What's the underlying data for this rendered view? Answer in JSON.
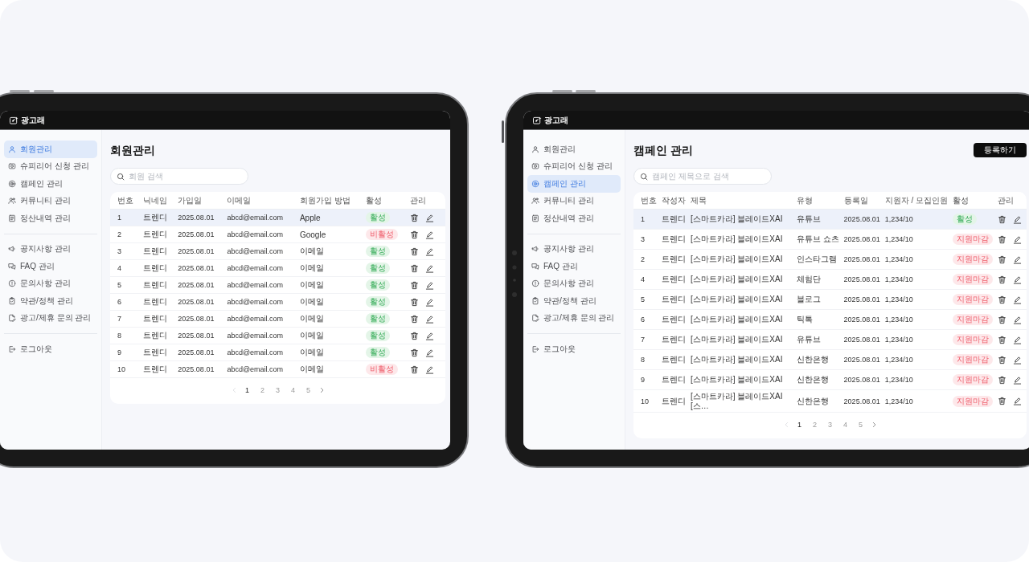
{
  "screens": [
    {
      "top_bar": {
        "logo": "광고래"
      },
      "sidebar": {
        "sections": [
          {
            "items": [
              {
                "label": "회원관리",
                "selected": true
              },
              {
                "label": "슈피리어 신청 관리",
                "selected": false
              },
              {
                "label": "캠페인 관리",
                "selected": false
              },
              {
                "label": "커뮤니티 관리",
                "selected": false
              },
              {
                "label": "정산내역 관리",
                "selected": false
              }
            ]
          },
          {
            "items": [
              {
                "label": "공지사항 관리",
                "selected": false
              },
              {
                "label": "FAQ 관리",
                "selected": false
              },
              {
                "label": "문의사항 관리",
                "selected": false
              },
              {
                "label": "약관/정책 관리",
                "selected": false
              },
              {
                "label": "광고/제휴 문의 관리",
                "selected": false
              }
            ]
          },
          {
            "items": [
              {
                "label": "로그아웃",
                "selected": false
              }
            ]
          }
        ]
      },
      "page": {
        "title": "회원관리",
        "search": {
          "placeholder": "회원 검색"
        },
        "table": {
          "columns": [
            {
              "label": "번호",
              "kind": "number"
            },
            {
              "label": "닉네임",
              "kind": "text"
            },
            {
              "label": "가입일",
              "kind": "figure"
            },
            {
              "label": "이메일",
              "kind": "figure"
            },
            {
              "label": "회원가입 방법",
              "kind": "text"
            },
            {
              "label": "활성",
              "kind": "status"
            },
            {
              "label": "관리",
              "kind": "actions"
            }
          ],
          "rows": [
            {
              "selected": true,
              "cells": [
                "1",
                "트렌디",
                "2025.08.01",
                "abcd@email.com",
                "Apple"
              ],
              "status": {
                "label": "활성",
                "active": true
              }
            },
            {
              "selected": false,
              "cells": [
                "2",
                "트렌디",
                "2025.08.01",
                "abcd@email.com",
                "Google"
              ],
              "status": {
                "label": "비활성",
                "active": false
              }
            },
            {
              "selected": false,
              "cells": [
                "3",
                "트렌디",
                "2025.08.01",
                "abcd@email.com",
                "이메일"
              ],
              "status": {
                "label": "활성",
                "active": true
              }
            },
            {
              "selected": false,
              "cells": [
                "4",
                "트렌디",
                "2025.08.01",
                "abcd@email.com",
                "이메일"
              ],
              "status": {
                "label": "활성",
                "active": true
              }
            },
            {
              "selected": false,
              "cells": [
                "5",
                "트렌디",
                "2025.08.01",
                "abcd@email.com",
                "이메일"
              ],
              "status": {
                "label": "활성",
                "active": true
              }
            },
            {
              "selected": false,
              "cells": [
                "6",
                "트렌디",
                "2025.08.01",
                "abcd@email.com",
                "이메일"
              ],
              "status": {
                "label": "활성",
                "active": true
              }
            },
            {
              "selected": false,
              "cells": [
                "7",
                "트렌디",
                "2025.08.01",
                "abcd@email.com",
                "이메일"
              ],
              "status": {
                "label": "활성",
                "active": true
              }
            },
            {
              "selected": false,
              "cells": [
                "8",
                "트렌디",
                "2025.08.01",
                "abcd@email.com",
                "이메일"
              ],
              "status": {
                "label": "활성",
                "active": true
              }
            },
            {
              "selected": false,
              "cells": [
                "9",
                "트렌디",
                "2025.08.01",
                "abcd@email.com",
                "이메일"
              ],
              "status": {
                "label": "활성",
                "active": true
              }
            },
            {
              "selected": false,
              "cells": [
                "10",
                "트렌디",
                "2025.08.01",
                "abcd@email.com",
                "이메일"
              ],
              "status": {
                "label": "비활성",
                "active": false
              }
            }
          ]
        },
        "pagination": {
          "previous": {
            "disabled": true
          },
          "pages": [
            {
              "label": "1",
              "selected": true
            },
            {
              "label": "2",
              "selected": false
            },
            {
              "label": "3",
              "selected": false
            },
            {
              "label": "4",
              "selected": false
            },
            {
              "label": "5",
              "selected": false
            }
          ],
          "next": {
            "disabled": false
          }
        }
      }
    },
    {
      "top_bar": {
        "logo": "광고래"
      },
      "sidebar": {
        "sections": [
          {
            "items": [
              {
                "label": "회원관리",
                "selected": false
              },
              {
                "label": "슈피리어 신청 관리",
                "selected": false
              },
              {
                "label": "캠페인 관리",
                "selected": true
              },
              {
                "label": "커뮤니티 관리",
                "selected": false
              },
              {
                "label": "정산내역 관리",
                "selected": false
              }
            ]
          },
          {
            "items": [
              {
                "label": "공지사항 관리",
                "selected": false
              },
              {
                "label": "FAQ 관리",
                "selected": false
              },
              {
                "label": "문의사항 관리",
                "selected": false
              },
              {
                "label": "약관/정책 관리",
                "selected": false
              },
              {
                "label": "광고/제휴 문의 관리",
                "selected": false
              }
            ]
          },
          {
            "items": [
              {
                "label": "로그아웃",
                "selected": false
              }
            ]
          }
        ]
      },
      "page": {
        "title": "캠페인 관리",
        "action_button": "등록하기",
        "search": {
          "placeholder": "캠페인 제목으로 검색"
        },
        "table": {
          "columns": [
            {
              "label": "번호",
              "kind": "number"
            },
            {
              "label": "작성자",
              "kind": "text"
            },
            {
              "label": "제목",
              "kind": "title"
            },
            {
              "label": "유형",
              "kind": "text"
            },
            {
              "label": "등록일",
              "kind": "figure"
            },
            {
              "label": "지원자 / 모집인원",
              "kind": "figure"
            },
            {
              "label": "활성",
              "kind": "status"
            },
            {
              "label": "관리",
              "kind": "actions"
            }
          ],
          "rows": [
            {
              "selected": true,
              "cells": [
                "1",
                "트렌디",
                "[스마트카라] 블레이드XAI",
                "유튜브",
                "2025.08.01",
                "1,234/10"
              ],
              "status": {
                "label": "활성",
                "active": true
              }
            },
            {
              "selected": false,
              "cells": [
                "3",
                "트렌디",
                "[스마트카라] 블레이드XAI",
                "유튜브 쇼츠",
                "2025.08.01",
                "1,234/10"
              ],
              "status": {
                "label": "지원마감",
                "active": false
              }
            },
            {
              "selected": false,
              "cells": [
                "2",
                "트렌디",
                "[스마트카라] 블레이드XAI",
                "인스타그램",
                "2025.08.01",
                "1,234/10"
              ],
              "status": {
                "label": "지원마감",
                "active": false
              }
            },
            {
              "selected": false,
              "cells": [
                "4",
                "트렌디",
                "[스마트카라] 블레이드XAI",
                "체험단",
                "2025.08.01",
                "1,234/10"
              ],
              "status": {
                "label": "지원마감",
                "active": false
              }
            },
            {
              "selected": false,
              "cells": [
                "5",
                "트렌디",
                "[스마트카라] 블레이드XAI",
                "블로그",
                "2025.08.01",
                "1,234/10"
              ],
              "status": {
                "label": "지원마감",
                "active": false
              }
            },
            {
              "selected": false,
              "cells": [
                "6",
                "트렌디",
                "[스마트카라] 블레이드XAI",
                "틱톡",
                "2025.08.01",
                "1,234/10"
              ],
              "status": {
                "label": "지원마감",
                "active": false
              }
            },
            {
              "selected": false,
              "cells": [
                "7",
                "트렌디",
                "[스마트카라] 블레이드XAI",
                "유튜브",
                "2025.08.01",
                "1,234/10"
              ],
              "status": {
                "label": "지원마감",
                "active": false
              }
            },
            {
              "selected": false,
              "cells": [
                "8",
                "트렌디",
                "[스마트카라] 블레이드XAI",
                "신한은행",
                "2025.08.01",
                "1,234/10"
              ],
              "status": {
                "label": "지원마감",
                "active": false
              }
            },
            {
              "selected": false,
              "cells": [
                "9",
                "트렌디",
                "[스마트카라] 블레이드XAI",
                "신한은행",
                "2025.08.01",
                "1,234/10"
              ],
              "status": {
                "label": "지원마감",
                "active": false
              }
            },
            {
              "selected": false,
              "cells": [
                "10",
                "트렌디",
                "[스마트카라] 블레이드XAI [스…",
                "신한은행",
                "2025.08.01",
                "1,234/10"
              ],
              "status": {
                "label": "지원마감",
                "active": false
              }
            }
          ]
        },
        "pagination": {
          "previous": {
            "disabled": true
          },
          "pages": [
            {
              "label": "1",
              "selected": true
            },
            {
              "label": "2",
              "selected": false
            },
            {
              "label": "3",
              "selected": false
            },
            {
              "label": "4",
              "selected": false
            },
            {
              "label": "5",
              "selected": false
            }
          ],
          "next": {
            "disabled": false
          }
        }
      }
    }
  ]
}
